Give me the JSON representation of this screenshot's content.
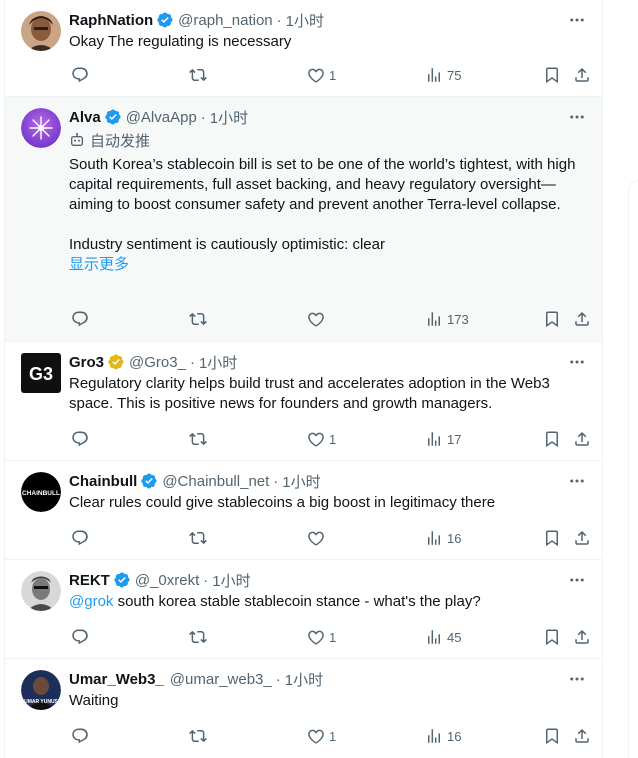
{
  "tweets": [
    {
      "name": "RaphNation",
      "verified": "blue",
      "handle": "@raph_nation",
      "time": "1小时",
      "text": "Okay The regulating is necessary",
      "counts": {
        "reply": "",
        "retweet": "",
        "like": "1",
        "views": "75"
      }
    },
    {
      "name": "Alva",
      "verified": "blue",
      "handle": "@AlvaApp",
      "time": "1小时",
      "automated": "自动发推",
      "text": "South Korea’s stablecoin bill is set to be one of the world’s tightest, with high capital requirements, full asset backing, and heavy regulatory oversight—aiming to boost consumer safety and prevent another Terra-level collapse.",
      "text2": "Industry sentiment is cautiously optimistic: clear",
      "show_more": "显示更多",
      "counts": {
        "reply": "",
        "retweet": "",
        "like": "",
        "views": "173"
      }
    },
    {
      "name": "Gro3",
      "verified": "gold",
      "handle": "@Gro3_",
      "time": "1小时",
      "avatar_text": "G3",
      "text": "Regulatory clarity helps build trust and accelerates adoption in the Web3 space. This is positive news for founders and growth managers.",
      "counts": {
        "reply": "",
        "retweet": "",
        "like": "1",
        "views": "17"
      }
    },
    {
      "name": "Chainbull",
      "verified": "blue",
      "handle": "@Chainbull_net",
      "time": "1小时",
      "avatar_text": "CHAINBULL",
      "text": "Clear rules could give stablecoins a big boost in legitimacy there",
      "counts": {
        "reply": "",
        "retweet": "",
        "like": "",
        "views": "16"
      }
    },
    {
      "name": "REKT",
      "verified": "blue",
      "handle": "@_0xrekt",
      "time": "1小时",
      "mention": "@grok",
      "text": " south korea stable stablecoin stance - what's the play?",
      "counts": {
        "reply": "",
        "retweet": "",
        "like": "1",
        "views": "45"
      }
    },
    {
      "name": "Umar_Web3_",
      "verified": "",
      "handle": "@umar_web3_",
      "time": "1小时",
      "avatar_text": "UMAR YUNUS",
      "text": "Waiting",
      "counts": {
        "reply": "",
        "retweet": "",
        "like": "1",
        "views": "16"
      }
    }
  ],
  "colors": {
    "accent": "#1d9bf0",
    "gold": "#e2b719",
    "muted": "#536471",
    "highlight_bg": "#f7f9f9"
  },
  "dot": "·"
}
